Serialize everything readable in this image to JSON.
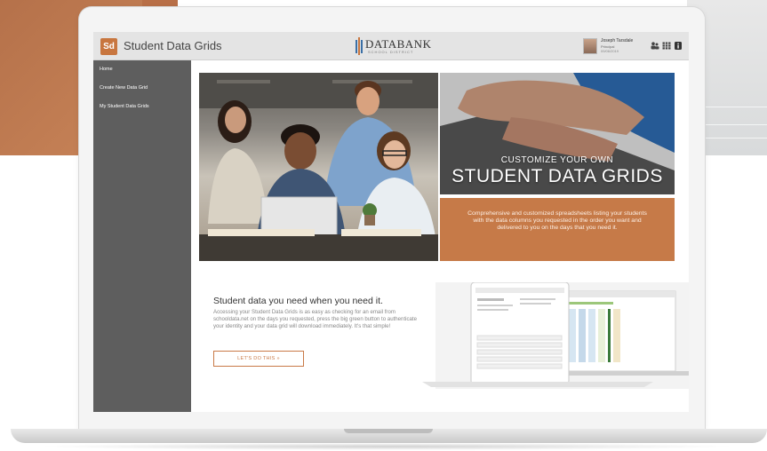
{
  "header": {
    "logo_badge": "Sd",
    "app_title": "Student Data Grids",
    "brand_name": "DATABANK",
    "brand_sub": "SCHOOL DISTRICT",
    "user": {
      "name": "Joseph Tarsdale",
      "role": "Principal",
      "date": "09/06/2019"
    },
    "icons": [
      "users-icon",
      "grid-menu-icon",
      "info-icon"
    ]
  },
  "sidebar": {
    "items": [
      {
        "label": "Home"
      },
      {
        "label": "Create New Data Grid"
      },
      {
        "label": "My Student Data Grids"
      }
    ]
  },
  "promo": {
    "title_line1": "CUSTOMIZE YOUR OWN",
    "title_line2": "STUDENT DATA GRIDS",
    "description": "Comprehensive and customized spreadsheets listing your students with the data columns you requested in the order you want and delivered to you on the days that you need it."
  },
  "lower": {
    "title": "Student data you need when you need it.",
    "text": "Accessing your Student Data Grids is as easy as checking for an email from schooldata.net on the days you requested, press the big green button to authenticate your identity and your data grid will download immediately. It's that simple!",
    "cta_label": "LET'S DO THIS »"
  },
  "colors": {
    "accent": "#c8763f",
    "sidebar": "#5e5e5e",
    "header": "#e4e4e4"
  }
}
